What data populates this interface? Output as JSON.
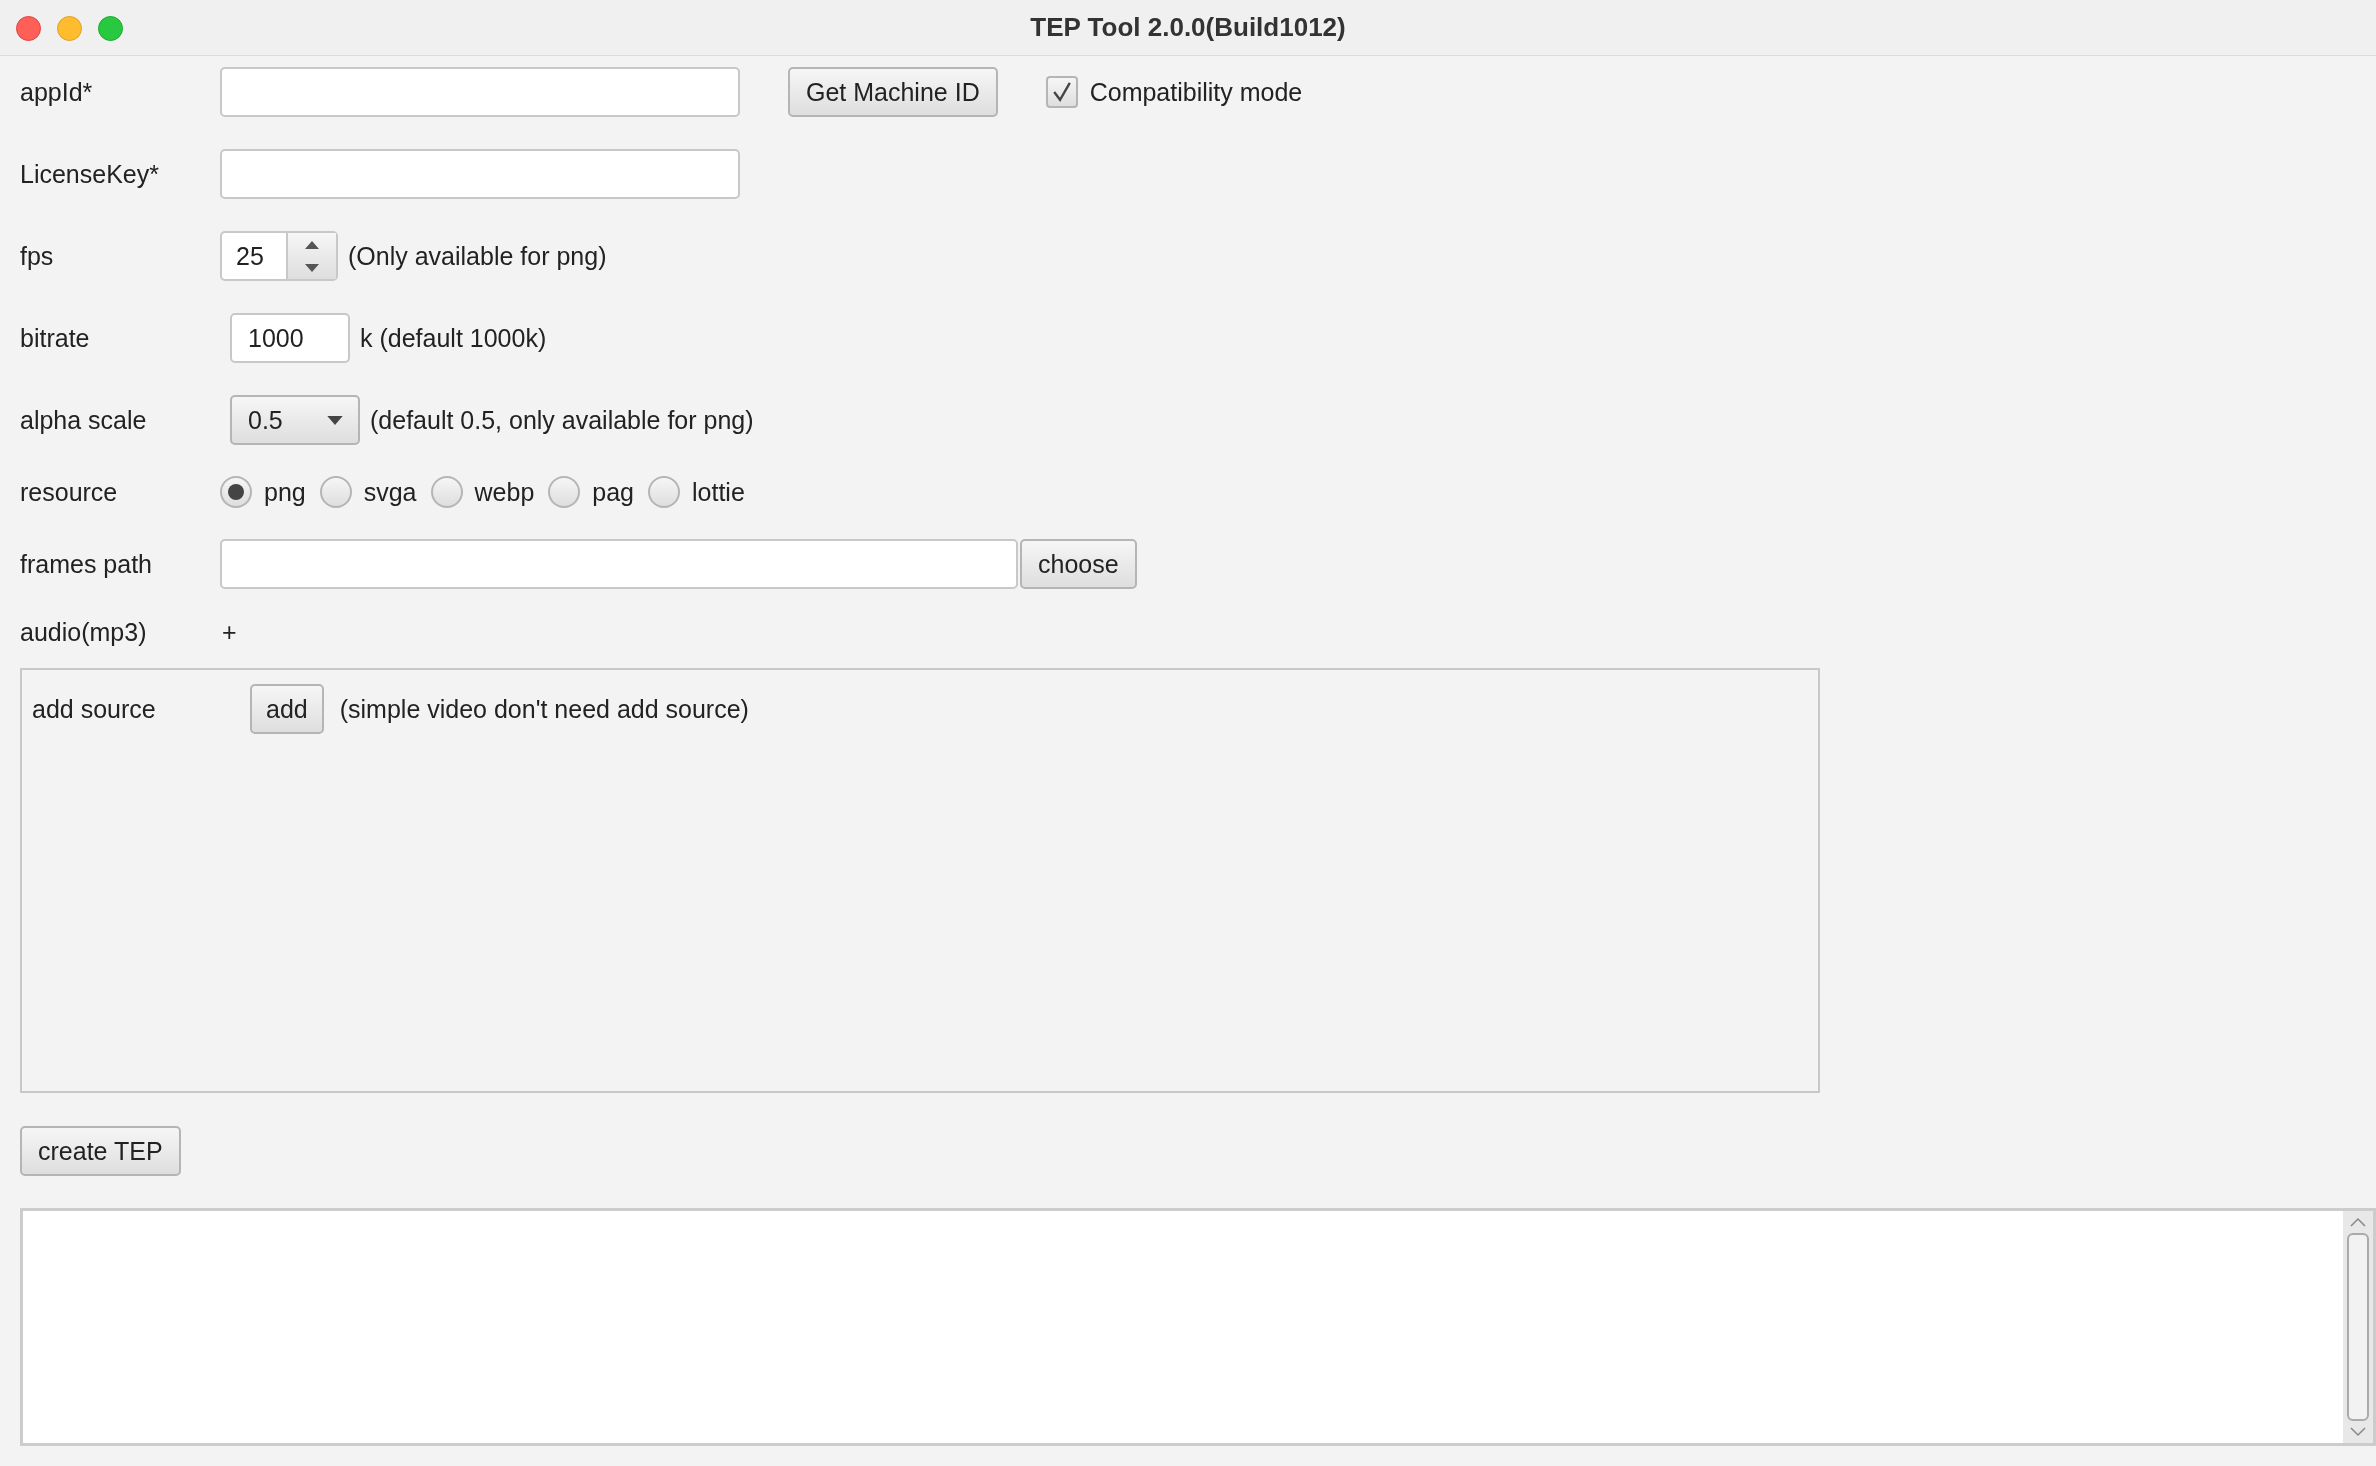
{
  "window": {
    "title": "TEP Tool 2.0.0(Build1012)"
  },
  "app_id": {
    "label": "appId*"
  },
  "get_machine_id": "Get Machine ID",
  "compatibility_mode": {
    "label": "Compatibility mode",
    "checked": true
  },
  "license_key": {
    "label": "LicenseKey*"
  },
  "fps": {
    "label": "fps",
    "value": "25",
    "note": "(Only available for png)"
  },
  "bitrate": {
    "label": "bitrate",
    "value": "1000",
    "note": "k (default 1000k)"
  },
  "alpha_scale": {
    "label": "alpha scale",
    "value": "0.5",
    "note": "(default 0.5, only available for png)"
  },
  "resource": {
    "label": "resource",
    "options": [
      {
        "label": "png",
        "selected": true
      },
      {
        "label": "svga",
        "selected": false
      },
      {
        "label": "webp",
        "selected": false
      },
      {
        "label": "pag",
        "selected": false
      },
      {
        "label": "lottie",
        "selected": false
      }
    ]
  },
  "frames_path": {
    "label": "frames path",
    "button": "choose"
  },
  "audio": {
    "label": "audio(mp3)",
    "add": "+"
  },
  "sources": {
    "label": "add source",
    "button": "add",
    "note": "(simple video don't need add source)"
  },
  "create_button": "create TEP"
}
